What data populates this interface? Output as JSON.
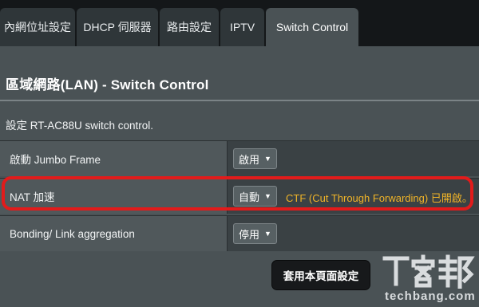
{
  "tabs": [
    {
      "label": "內網位址設定",
      "active": false
    },
    {
      "label": "DHCP 伺服器",
      "active": false
    },
    {
      "label": "路由設定",
      "active": false
    },
    {
      "label": "IPTV",
      "active": false
    },
    {
      "label": "Switch Control",
      "active": true
    }
  ],
  "page": {
    "title": "區域網路(LAN) - Switch Control",
    "description": "設定 RT-AC88U switch control."
  },
  "settings": [
    {
      "label": "啟動 Jumbo Frame",
      "value": "啟用"
    },
    {
      "label": "NAT 加速",
      "value": "自動",
      "note": "CTF (Cut Through Forwarding) 已開啟。"
    },
    {
      "label": "Bonding/ Link aggregation",
      "value": "停用"
    }
  ],
  "apply_button": "套用本頁面設定",
  "watermark": {
    "logo_text": "T客邦",
    "text": "techbang.com"
  },
  "colors": {
    "highlight": "#e21b1b",
    "note": "#f0b428",
    "panel": "#4a5255",
    "button": "#17191b"
  }
}
